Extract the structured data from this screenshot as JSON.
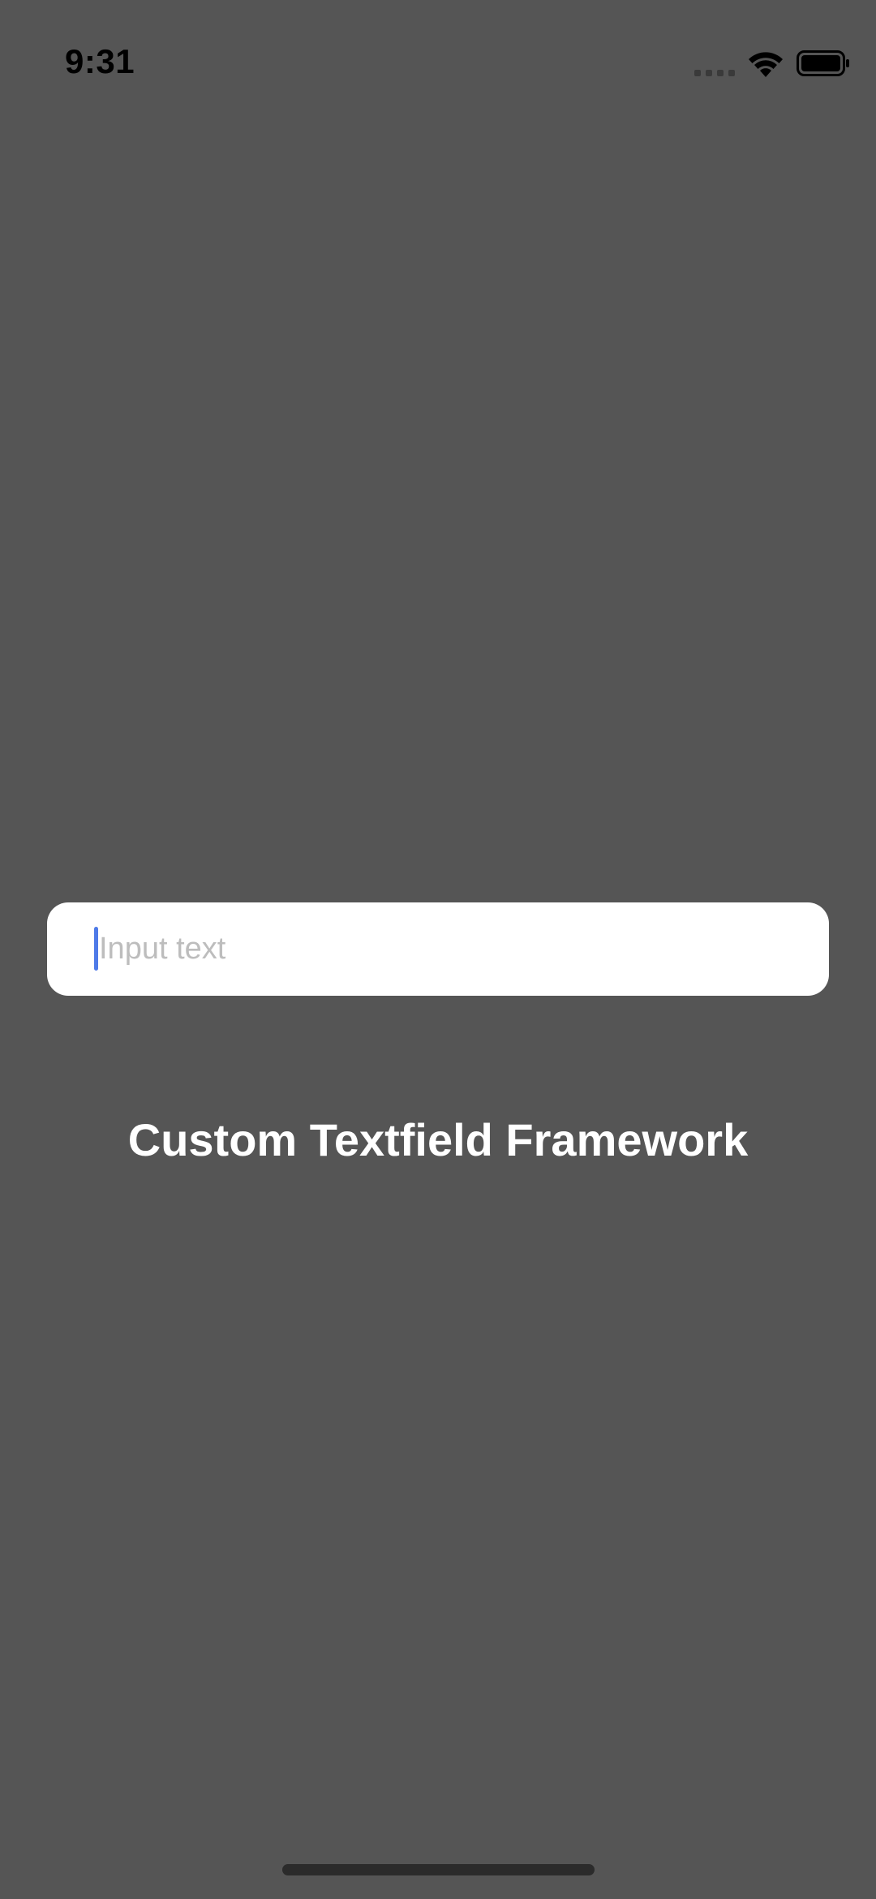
{
  "status_bar": {
    "time": "9:31",
    "signal_icon": "cellular-signal-icon",
    "wifi_icon": "wifi-icon",
    "battery_icon": "battery-icon"
  },
  "text_field": {
    "value": "",
    "placeholder": "Input text",
    "cursor_color": "#4e7ae8"
  },
  "title": "Custom Textfield Framework",
  "colors": {
    "background": "#555555",
    "field_background": "#ffffff",
    "placeholder": "#bdbdbd",
    "title": "#ffffff"
  }
}
